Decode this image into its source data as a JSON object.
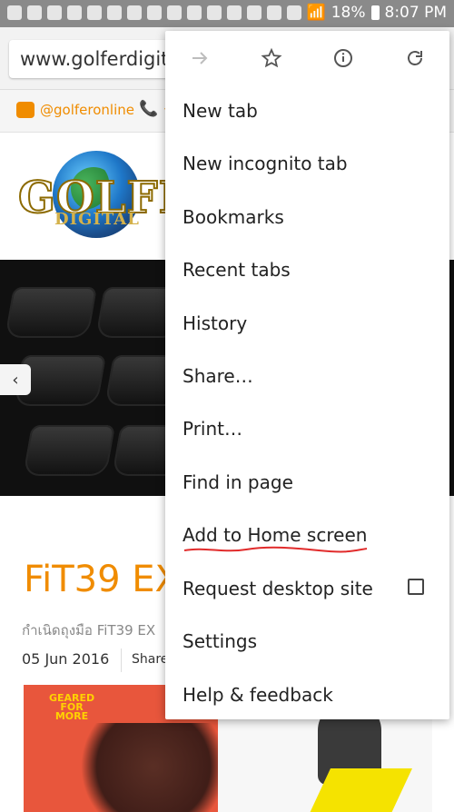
{
  "status_bar": {
    "battery": "18%",
    "time": "8:07 PM",
    "left_icons": [
      "message-icon",
      "youtube-icon",
      "line-icon",
      "line-icon",
      "line-icon",
      "mute-icon",
      "mute-icon",
      "mute-icon",
      "sim-icon",
      "image-icon",
      "download-icon",
      "download-icon",
      "chrome-icon",
      "clipboard-icon",
      "sync-icon"
    ]
  },
  "browser": {
    "url": "www.golferdigital.com"
  },
  "site": {
    "line_handle": "@golferonline",
    "phone_prefix": "+",
    "logo_text": "GOLFER",
    "logo_subtext": "DIGITAL"
  },
  "content": {
    "title": "FiT39 EX",
    "subtitle": "กำเนิดถุงมือ FiT39 EX",
    "date": "05 Jun 2016",
    "share": "Share",
    "left_thumb_text": "GEARED FOR MORE"
  },
  "menu": {
    "top_actions": [
      {
        "name": "forward-icon"
      },
      {
        "name": "bookmark-star-icon"
      },
      {
        "name": "info-icon"
      },
      {
        "name": "reload-icon"
      }
    ],
    "items": [
      {
        "label": "New tab"
      },
      {
        "label": "New incognito tab"
      },
      {
        "label": "Bookmarks"
      },
      {
        "label": "Recent tabs"
      },
      {
        "label": "History"
      },
      {
        "label": "Share…"
      },
      {
        "label": "Print…"
      },
      {
        "label": "Find in page"
      },
      {
        "label": "Add to Home screen"
      },
      {
        "label": "Request desktop site",
        "checkbox": false
      },
      {
        "label": "Settings"
      },
      {
        "label": "Help & feedback"
      }
    ]
  },
  "colors": {
    "accent_orange": "#f08c00",
    "status_bar": "#8a8a8a",
    "menu_bg": "#ffffff",
    "underline_red": "#e12b2b"
  }
}
